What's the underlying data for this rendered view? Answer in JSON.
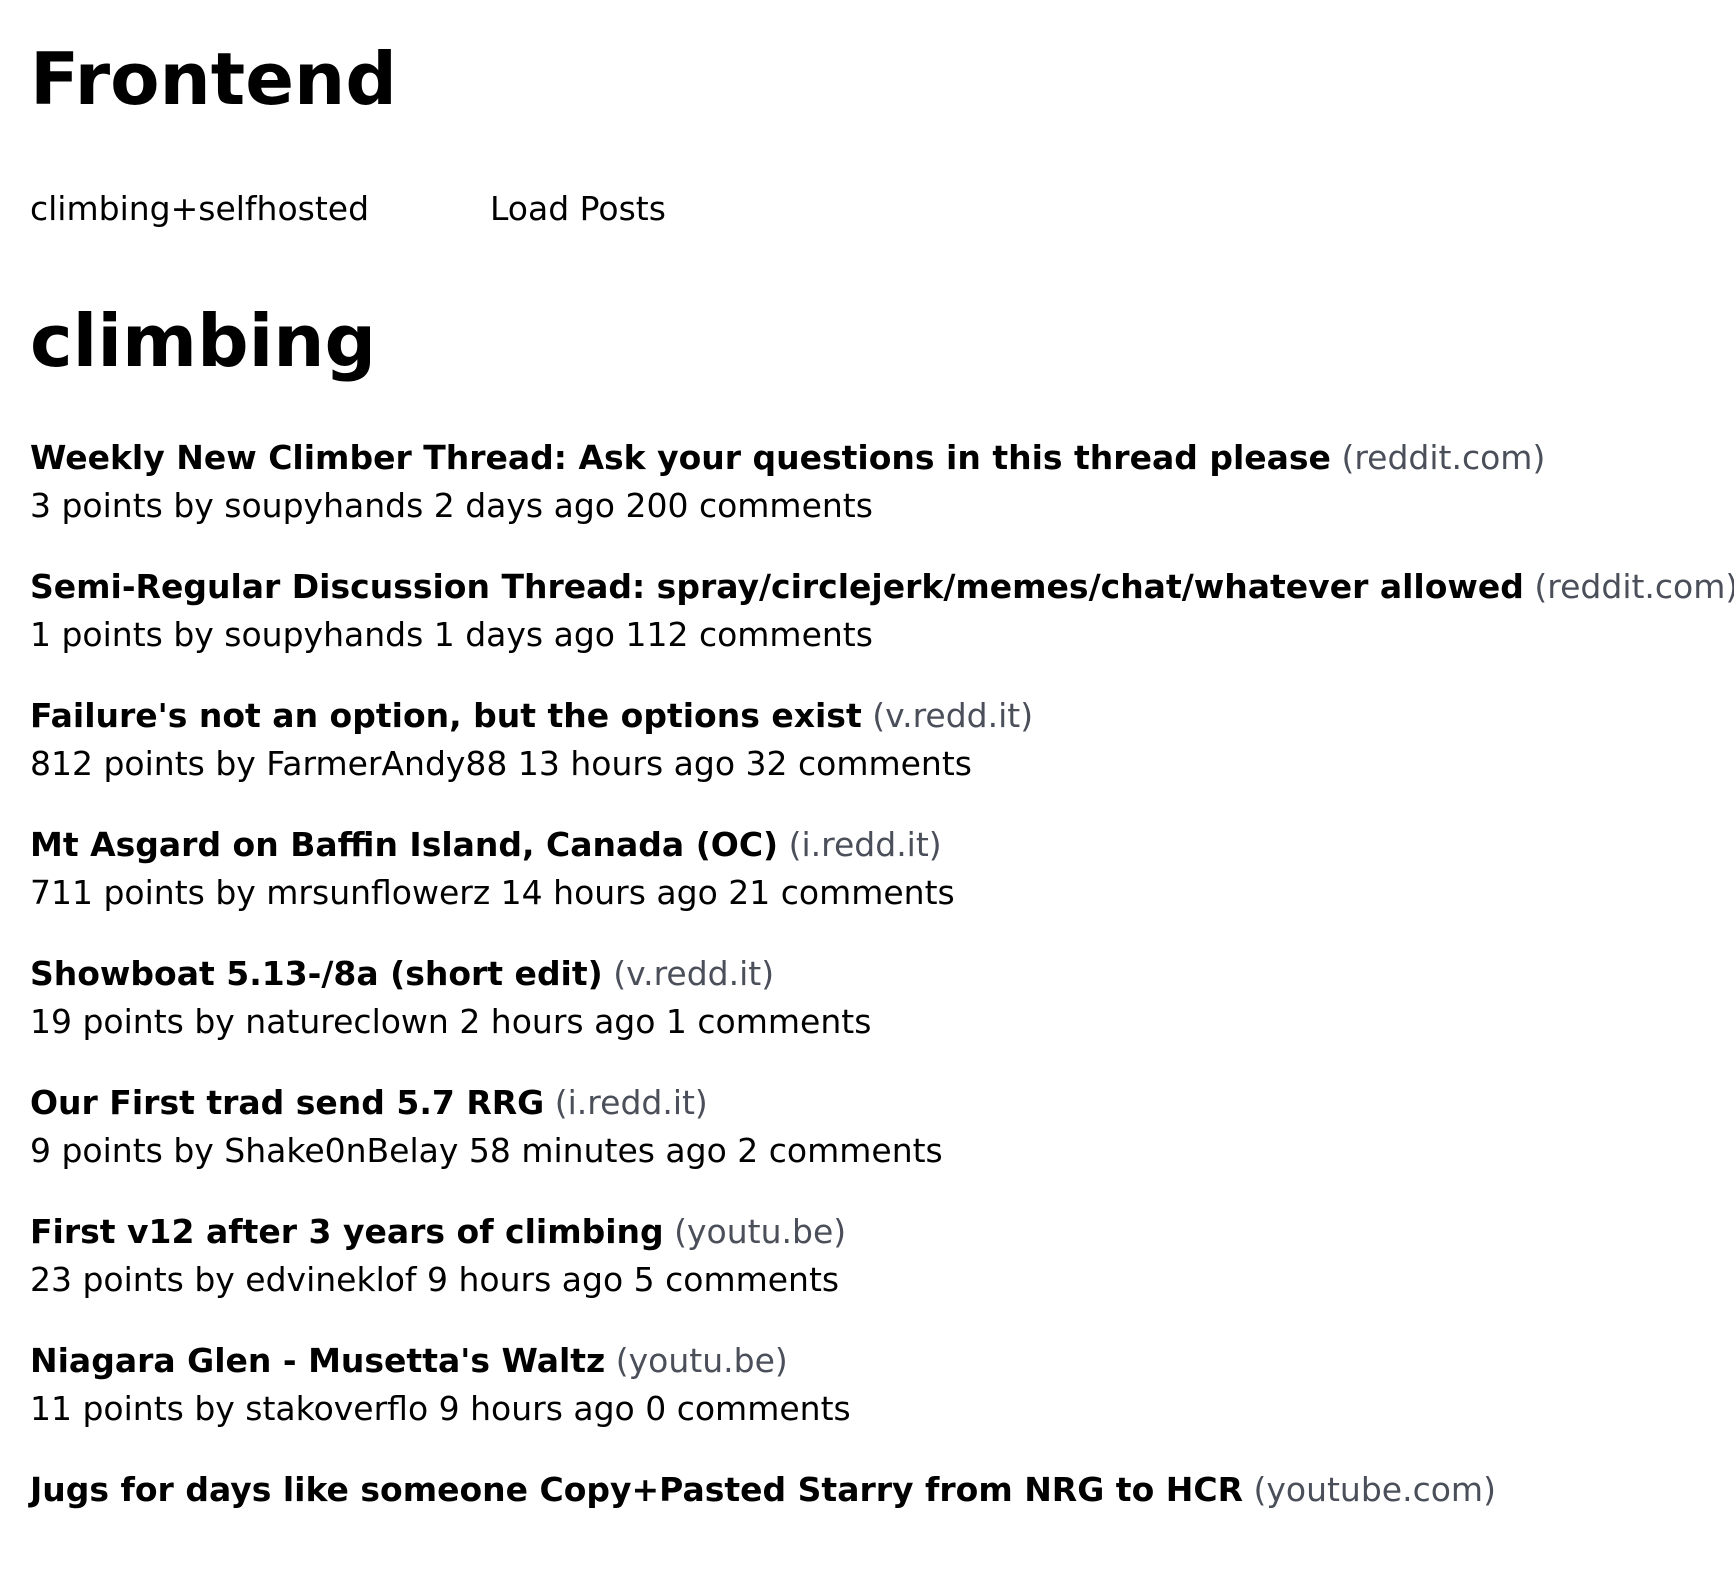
{
  "app": {
    "title": "Frontend"
  },
  "controls": {
    "subreddit_value": "climbing+selfhosted",
    "load_button_label": "Load Posts"
  },
  "section": {
    "title": "climbing"
  },
  "posts": [
    {
      "title": "Weekly New Climber Thread: Ask your questions in this thread please",
      "domain": "(reddit.com)",
      "meta": "3 points by soupyhands 2 days ago 200 comments"
    },
    {
      "title": "Semi-Regular Discussion Thread: spray/circlejerk/memes/chat/whatever allowed",
      "domain": "(reddit.com)",
      "meta": "1 points by soupyhands 1 days ago 112 comments"
    },
    {
      "title": "Failure's not an option, but the options exist",
      "domain": "(v.redd.it)",
      "meta": "812 points by FarmerAndy88 13 hours ago 32 comments"
    },
    {
      "title": "Mt Asgard on Baffin Island, Canada (OC)",
      "domain": "(i.redd.it)",
      "meta": "711 points by mrsunflowerz 14 hours ago 21 comments"
    },
    {
      "title": "Showboat 5.13-/8a (short edit)",
      "domain": "(v.redd.it)",
      "meta": "19 points by natureclown 2 hours ago 1 comments"
    },
    {
      "title": "Our First trad send 5.7 RRG",
      "domain": "(i.redd.it)",
      "meta": "9 points by Shake0nBelay 58 minutes ago 2 comments"
    },
    {
      "title": "First v12 after 3 years of climbing",
      "domain": "(youtu.be)",
      "meta": "23 points by edvineklof 9 hours ago 5 comments"
    },
    {
      "title": "Niagara Glen - Musetta's Waltz",
      "domain": "(youtu.be)",
      "meta": "11 points by stakoverflo 9 hours ago 0 comments"
    },
    {
      "title": "Jugs for days like someone Copy+Pasted Starry from NRG to HCR",
      "domain": "(youtube.com)",
      "meta": ""
    }
  ]
}
